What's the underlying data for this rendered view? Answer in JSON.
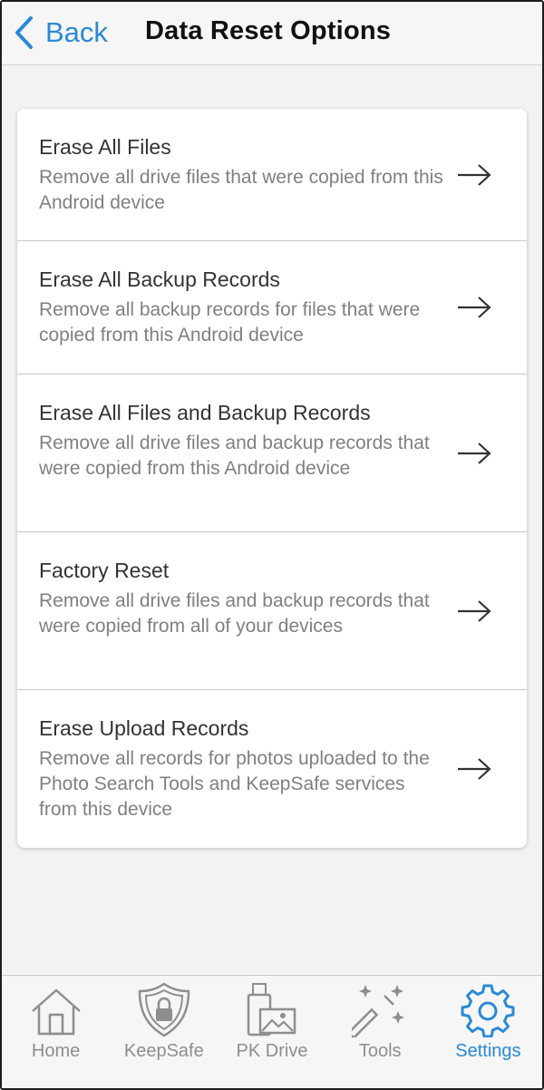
{
  "header": {
    "back_label": "Back",
    "title": "Data Reset Options"
  },
  "options": [
    {
      "title": "Erase All Files",
      "description": "Remove all drive files that were copied from this Android device"
    },
    {
      "title": "Erase All Backup Records",
      "description": "Remove all backup records for files that were copied from this Android device"
    },
    {
      "title": "Erase All Files and Backup Records",
      "description": "Remove all drive files and backup records that were copied from this Android device"
    },
    {
      "title": "Factory Reset",
      "description": "Remove all drive files and backup records that were copied from all of your devices"
    },
    {
      "title": "Erase Upload Records",
      "description": "Remove all records for photos uploaded to the Photo Search Tools and KeepSafe services from this device"
    }
  ],
  "tabbar": {
    "tabs": [
      {
        "label": "Home",
        "icon": "home-icon"
      },
      {
        "label": "KeepSafe",
        "icon": "shield-lock-icon"
      },
      {
        "label": "PK Drive",
        "icon": "usb-drive-photo-icon"
      },
      {
        "label": "Tools",
        "icon": "magic-wand-icon"
      },
      {
        "label": "Settings",
        "icon": "gear-icon"
      }
    ],
    "active": "Settings"
  },
  "colors": {
    "accent": "#2a8ad6",
    "inactive": "#8e8e8e",
    "background": "#f2f2f2"
  }
}
